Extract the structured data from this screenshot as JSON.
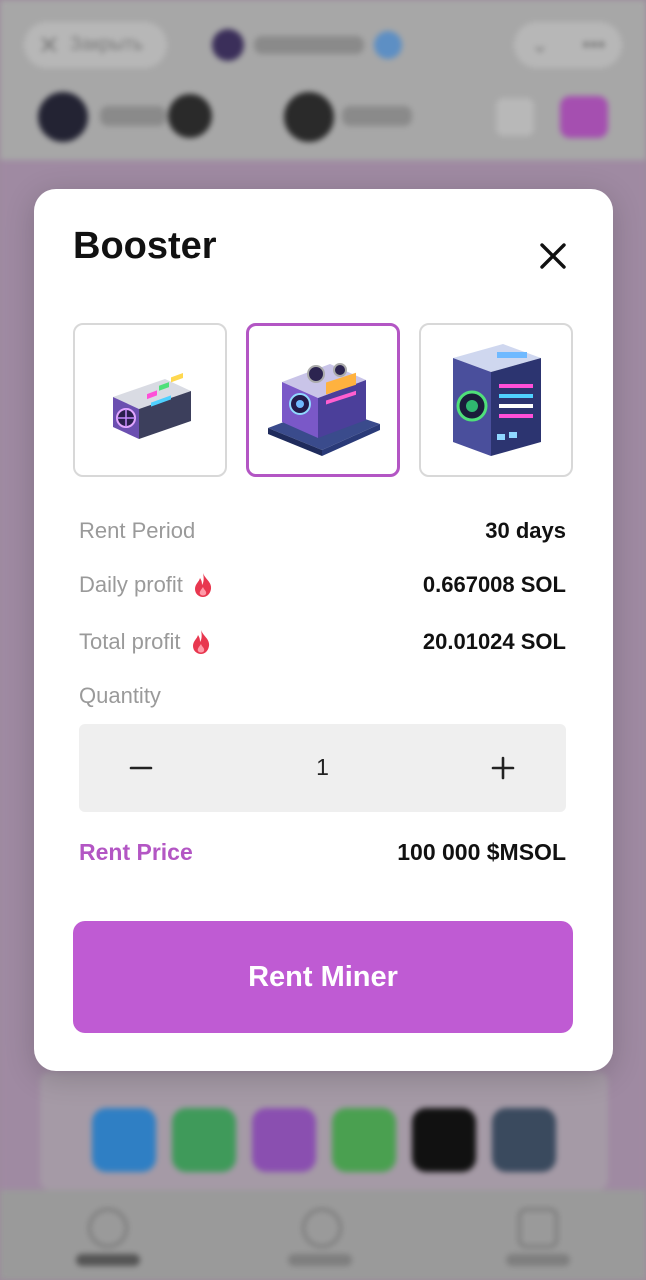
{
  "background": {
    "close_label": "Закрыть"
  },
  "modal": {
    "title": "Booster",
    "items": [
      {
        "name": "miner-1"
      },
      {
        "name": "miner-2",
        "selected": true
      },
      {
        "name": "miner-3"
      }
    ],
    "rent_period": {
      "label": "Rent Period",
      "value": "30 days"
    },
    "daily_profit": {
      "label": "Daily profit",
      "value": "0.667008 SOL"
    },
    "total_profit": {
      "label": "Total profit",
      "value": "20.01024 SOL"
    },
    "quantity": {
      "label": "Quantity",
      "value": "1"
    },
    "rent_price": {
      "label": "Rent Price",
      "value": "100 000 $MSOL"
    },
    "cta_label": "Rent Miner"
  },
  "colors": {
    "accent": "#bf5bd3",
    "accent_text": "#b356c4",
    "fire": "#e8374f"
  },
  "icons": {
    "close": "close-icon",
    "fire": "fire-icon",
    "minus": "minus-icon",
    "plus": "plus-icon"
  }
}
